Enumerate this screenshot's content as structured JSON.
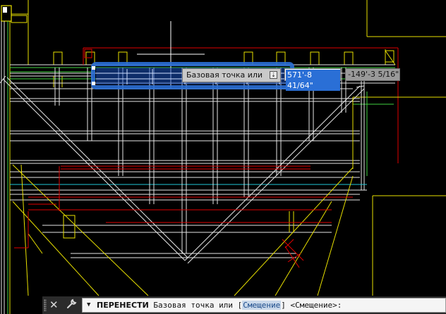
{
  "dynamic_input": {
    "prompt": "Базовая точка или",
    "prompt_icon": "download-arrow-icon",
    "x_value": "571'-8 41/64\"",
    "y_value": "-149'-3 5/16\""
  },
  "command_line": {
    "close_glyph": "✕",
    "tool_glyph": "🔧",
    "caret": "▼",
    "command": "ПЕРЕНЕСТИ",
    "prompt_text": " Базовая точка или [",
    "option": "Смещение",
    "prompt_tail": "] <Смещение>:"
  },
  "colors": {
    "background": "#000000",
    "white_lines": "#e6e6e6",
    "yellow_lines": "#e8e000",
    "red_lines": "#e00000",
    "green_lines": "#3fd23f",
    "cyan_lines": "#20c8d8",
    "selection_blue": "#2a6fd6"
  }
}
